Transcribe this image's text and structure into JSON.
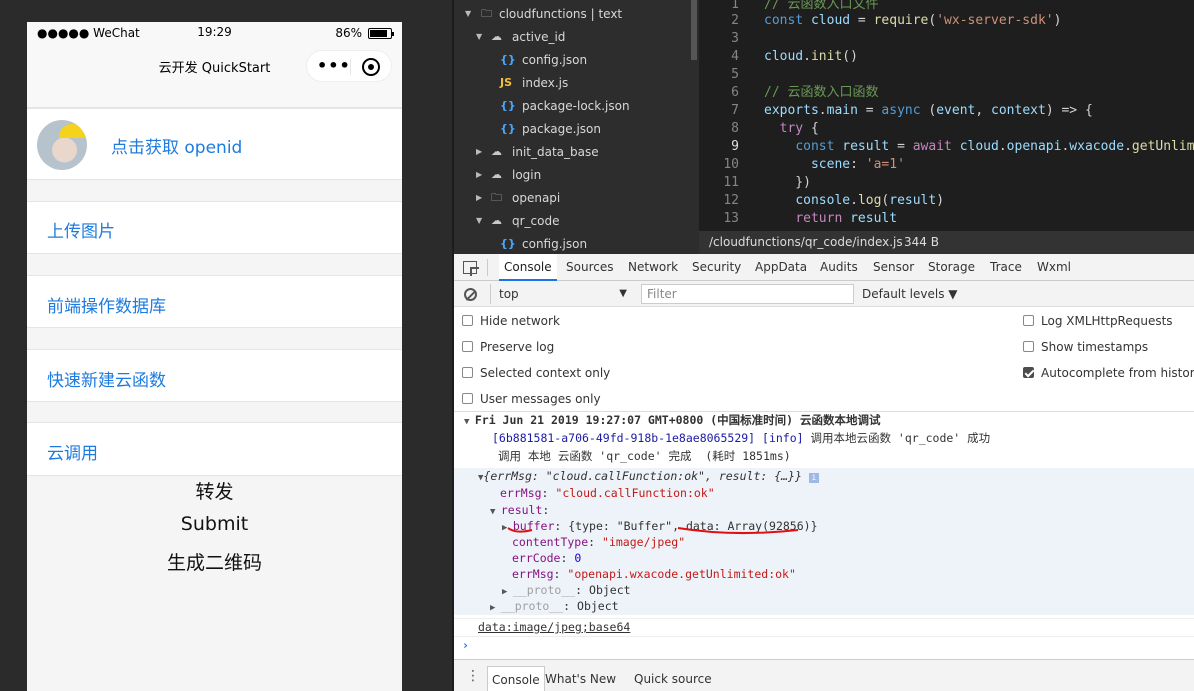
{
  "phone": {
    "status": {
      "carrier": "●●●●● WeChat",
      "time": "19:29",
      "battery": "86%"
    },
    "nav_title": "云开发 QuickStart",
    "capsule_more": "•••",
    "rows": {
      "openid": "点击获取 openid",
      "upload": "上传图片",
      "db": "前端操作数据库",
      "newfn": "快速新建云函数",
      "call": "云调用"
    },
    "buttons": {
      "forward": "转发",
      "submit": "Submit",
      "qrcode": "生成二维码"
    }
  },
  "filetree": {
    "items": [
      {
        "label": "cloudfunctions | text"
      },
      {
        "label": "active_id"
      },
      {
        "label": "config.json"
      },
      {
        "label": "index.js"
      },
      {
        "label": "package-lock.json"
      },
      {
        "label": "package.json"
      },
      {
        "label": "init_data_base"
      },
      {
        "label": "login"
      },
      {
        "label": "openapi"
      },
      {
        "label": "qr_code"
      },
      {
        "label": "config.json"
      }
    ]
  },
  "editor": {
    "line_numbers": [
      "1",
      "2",
      "3",
      "4",
      "5",
      "6",
      "7",
      "8",
      "9",
      "10",
      "11",
      "12",
      "13"
    ],
    "status_path": "/cloudfunctions/qr_code/index.js",
    "status_size": "344 B"
  },
  "devtools": {
    "tabs": [
      "Console",
      "Sources",
      "Network",
      "Security",
      "AppData",
      "Audits",
      "Sensor",
      "Storage",
      "Trace",
      "Wxml"
    ],
    "context": "top",
    "filter_placeholder": "Filter",
    "levels": "Default levels ▼",
    "settings": {
      "hide_network": "Hide network",
      "preserve_log": "Preserve log",
      "selected_context": "Selected context only",
      "user_messages": "User messages only",
      "log_xhr": "Log XMLHttpRequests",
      "show_timestamps": "Show timestamps",
      "autocomplete": "Autocomplete from history"
    },
    "console": {
      "group_header": "Fri Jun 21 2019 19:27:07 GMT+0800 (中国标准时间) 云函数本地调试",
      "info_id": "[6b881581-a706-49fd-918b-1e8ae8065529] [info]",
      "info_msg": "调用本地云函数 'qr_code' 成功",
      "done_msg": "调用 本地 云函数 'qr_code' 完成  (耗时 1851ms)",
      "obj_summary": "{errMsg: \"cloud.callFunction:ok\", result: {…}}",
      "errMsg_key": "errMsg",
      "errMsg_val": "\"cloud.callFunction:ok\"",
      "result_key": "result",
      "buffer_key": "buffer",
      "buffer_val": "{type: \"Buffer\", data: Array(92856)}",
      "contentType_key": "contentType",
      "contentType_val": "\"image/jpeg\"",
      "errCode_key": "errCode",
      "errCode_val": "0",
      "errMsg2_key": "errMsg",
      "errMsg2_val": "\"openapi.wxacode.getUnlimited:ok\"",
      "proto_key": "__proto__",
      "proto_val": "Object",
      "data_line": "data:image/jpeg;base64",
      "prompt": "›"
    },
    "bottom_tabs": [
      "Console",
      "What's New",
      "Quick source"
    ]
  },
  "colors": {
    "link_blue": "#1e7be0",
    "editor_bg": "#1e1e1e",
    "tree_bg": "#2d2d2d",
    "annotation_red": "#e01010"
  }
}
